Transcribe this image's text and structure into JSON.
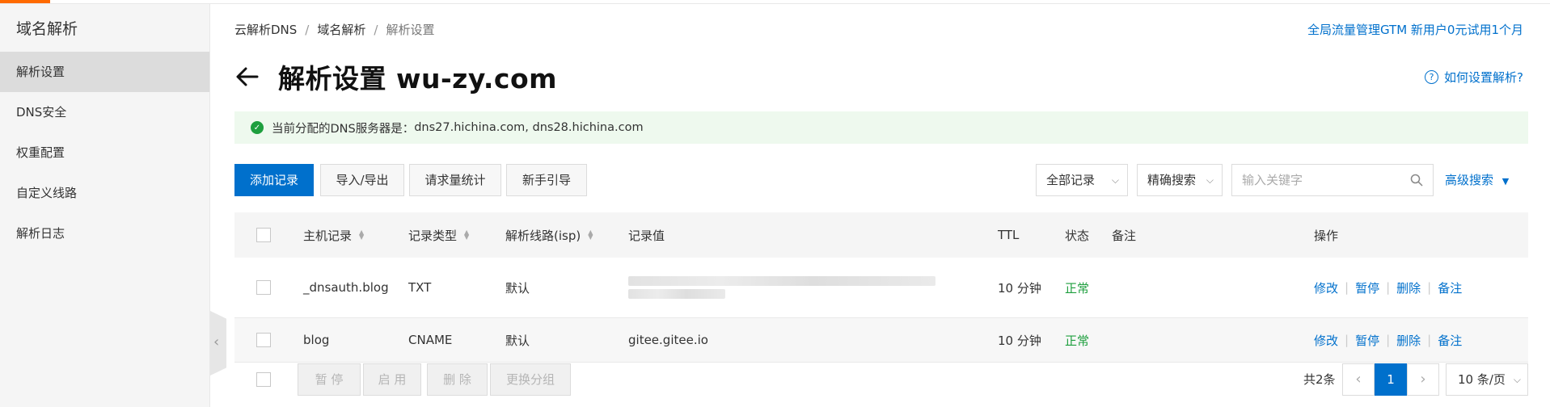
{
  "colors": {
    "accent": "#0070cc",
    "brand_top": "#ff6a00",
    "success": "#1e9f3e",
    "notice_bg": "#eef9ee"
  },
  "sidebar": {
    "title": "域名解析",
    "items": [
      {
        "label": "解析设置",
        "active": true
      },
      {
        "label": "DNS安全",
        "active": false
      },
      {
        "label": "权重配置",
        "active": false
      },
      {
        "label": "自定义线路",
        "active": false
      },
      {
        "label": "解析日志",
        "active": false
      }
    ]
  },
  "breadcrumb": [
    "云解析DNS",
    "域名解析",
    "解析设置"
  ],
  "promo_link": "全局流量管理GTM 新用户0元试用1个月",
  "page": {
    "title": "解析设置 wu-zy.com",
    "help_link": "如何设置解析?"
  },
  "notice": {
    "label": "当前分配的DNS服务器是：",
    "servers": "dns27.hichina.com, dns28.hichina.com"
  },
  "toolbar": {
    "add_record": "添加记录",
    "import_export": "导入/导出",
    "request_stats": "请求量统计",
    "guide": "新手引导",
    "filter_select": "全部记录",
    "search_mode": "精确搜索",
    "search_placeholder": "输入关键字",
    "advanced_search": "高级搜索"
  },
  "table": {
    "headers": {
      "host": "主机记录",
      "type": "记录类型",
      "line": "解析线路(isp)",
      "value": "记录值",
      "ttl": "TTL",
      "status": "状态",
      "remark": "备注",
      "actions": "操作"
    },
    "rows": [
      {
        "host": "_dnsauth.blog",
        "type": "TXT",
        "line": "默认",
        "value": "",
        "ttl": "10 分钟",
        "status": "正常"
      },
      {
        "host": "blog",
        "type": "CNAME",
        "line": "默认",
        "value": "gitee.gitee.io",
        "ttl": "10 分钟",
        "status": "正常"
      }
    ],
    "row_actions": [
      "修改",
      "暂停",
      "删除",
      "备注"
    ]
  },
  "footer": {
    "bulk": [
      "暂 停",
      "启 用",
      "删 除",
      "更换分组"
    ],
    "total": "共2条",
    "current_page": "1",
    "page_size": "10 条/页"
  }
}
